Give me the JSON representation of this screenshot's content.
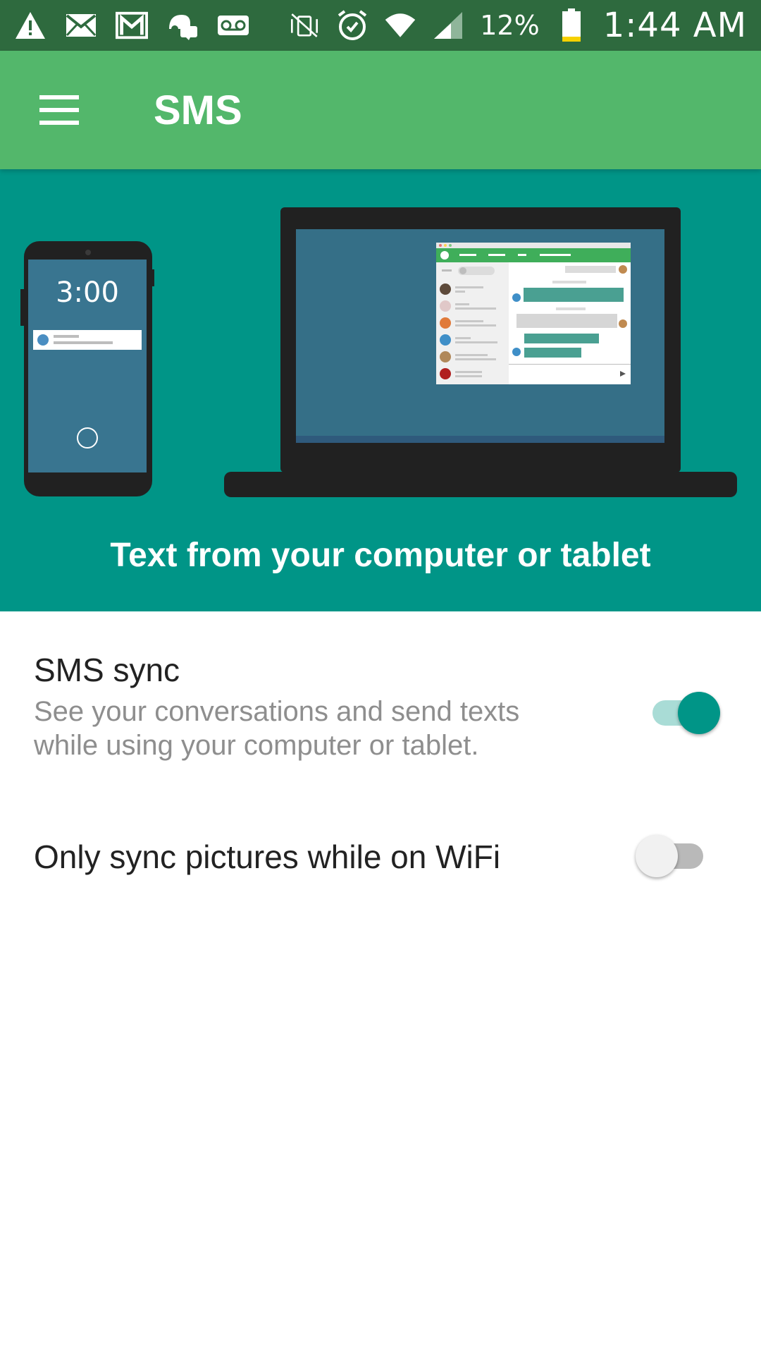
{
  "status_bar": {
    "battery_text": "12%",
    "time": "1:44 AM",
    "icons": [
      "warning-icon",
      "email-icon",
      "gmail-icon",
      "hangouts-icon",
      "voicemail-icon",
      "vibrate-icon",
      "alarm-icon",
      "wifi-icon",
      "signal-icon",
      "battery-icon"
    ]
  },
  "app_bar": {
    "title": "SMS"
  },
  "hero": {
    "phone_clock": "3:00",
    "caption": "Text from your computer or tablet"
  },
  "settings": {
    "sms_sync": {
      "title": "SMS sync",
      "subtitle": "See your conversations and send texts while using your computer or tablet.",
      "enabled": true
    },
    "wifi_only": {
      "title": "Only sync pictures while on WiFi",
      "enabled": false
    }
  },
  "colors": {
    "status_bar": "#2e6a3e",
    "app_bar": "#53b76b",
    "hero": "#009587",
    "switch_on_thumb": "#009587",
    "switch_on_track": "#a9dcd6"
  }
}
